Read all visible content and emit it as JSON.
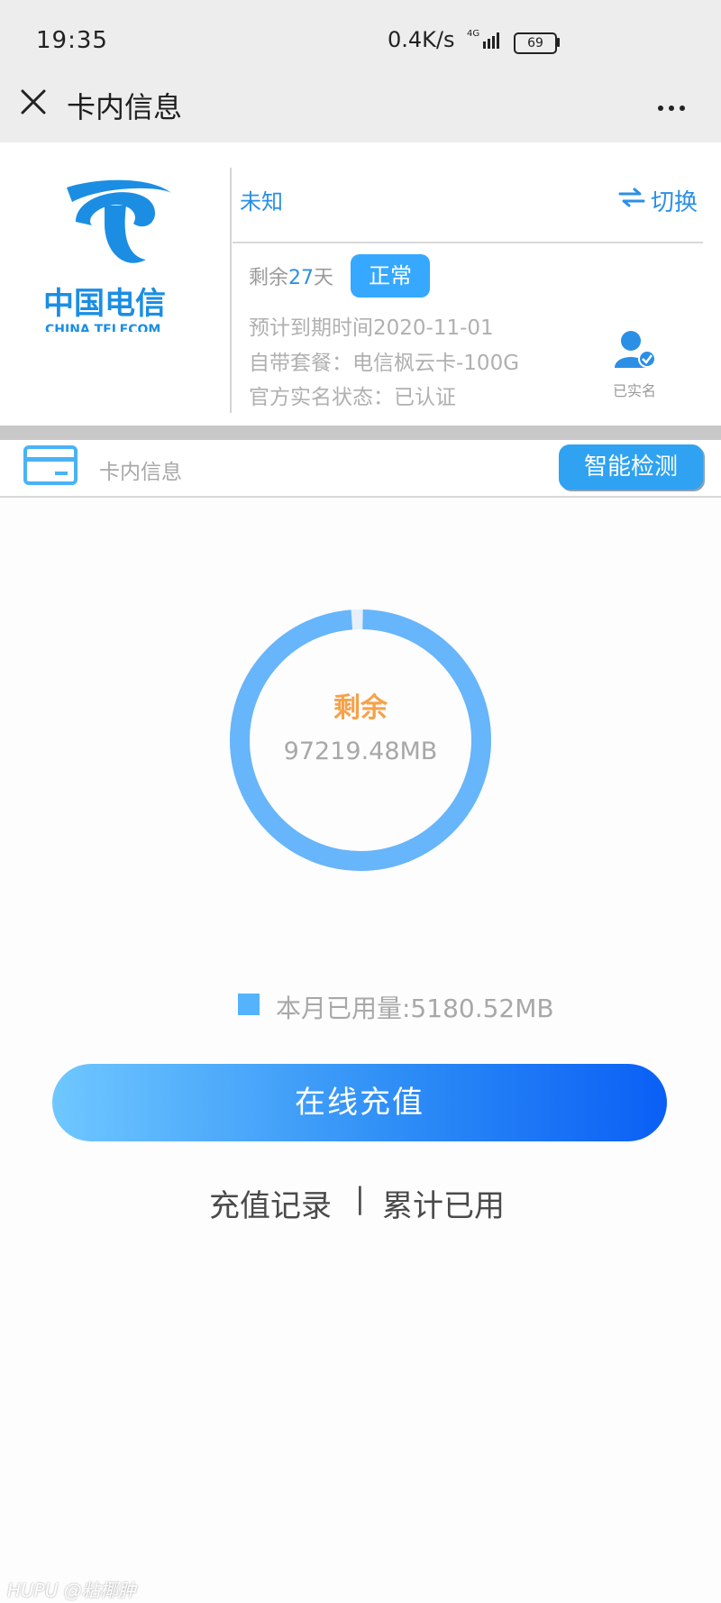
{
  "status_bar": {
    "time": "19:35",
    "speed": "0.4K/s",
    "network": "4G",
    "battery": "69"
  },
  "title_bar": {
    "title": "卡内信息",
    "close_icon": "close-icon",
    "more_icon": "more-icon"
  },
  "card": {
    "carrier": "未知",
    "switch_label": "切换",
    "remain_prefix": "剩余",
    "remain_days": "27",
    "remain_suffix": "天",
    "status_badge": "正常",
    "expiry": "预计到期时间2020-11-01",
    "plan": "自带套餐：电信枫云卡-100G",
    "realname": "官方实名状态：已认证",
    "verified_label": "已实名",
    "logo_text_cn": "中国电信",
    "logo_text_en": "CHINA TELECOM"
  },
  "section": {
    "title": "卡内信息",
    "detect_button": "智能检测"
  },
  "usage": {
    "ring_label": "剩余",
    "remaining": "97219.48MB",
    "used_label": "本月已用量:5180.52MB",
    "remaining_fraction": 0.985
  },
  "actions": {
    "recharge": "在线充值",
    "recharge_records": "充值记录",
    "separator": "|",
    "total_used": "累计已用"
  },
  "watermark": "HUPU @粘椰肿",
  "colors": {
    "accent": "#2b8fe6",
    "ring": "#67b5fb",
    "badge": "#36a8ff",
    "orange": "#f5a24a"
  }
}
